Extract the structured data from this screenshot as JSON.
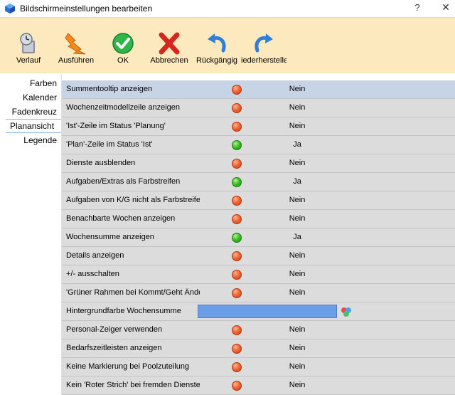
{
  "window": {
    "title": "Bildschirmeinstellungen bearbeiten",
    "help_label": "?",
    "close_label": "✕"
  },
  "toolbar": {
    "buttons": [
      {
        "label": "Verlauf",
        "icon": "history-icon"
      },
      {
        "label": "Ausführen",
        "icon": "execute-lightning-icon"
      },
      {
        "label": "OK",
        "icon": "ok-check-icon"
      },
      {
        "label": "Abbrechen",
        "icon": "cancel-x-icon"
      },
      {
        "label": "Rückgängig",
        "icon": "undo-arrow-icon"
      },
      {
        "label": "iederherstelle",
        "icon": "redo-arrow-icon"
      }
    ]
  },
  "sidebar": {
    "items": [
      {
        "label": "Farben",
        "active": false
      },
      {
        "label": "Kalender",
        "active": false
      },
      {
        "label": "Fadenkreuz",
        "active": false
      },
      {
        "label": "Planansicht",
        "active": true
      },
      {
        "label": "Legende",
        "active": false
      }
    ]
  },
  "colors": {
    "toolbar_bg": "#fde9be",
    "row_bg": "#dcdcdc",
    "selected_row_bg": "#c6d4e6",
    "status_no": "#e8562a",
    "status_yes": "#3fc22e",
    "color_field": "#6a9ee6"
  },
  "settings": [
    {
      "name": "Summentooltip anzeigen",
      "status": "red",
      "value": "Nein"
    },
    {
      "name": "Wochenzeitmodellzeile anzeigen",
      "status": "red",
      "value": "Nein"
    },
    {
      "name": "'Ist'-Zeile im Status 'Planung'",
      "status": "red",
      "value": "Nein"
    },
    {
      "name": "'Plan'-Zeile im Status 'Ist'",
      "status": "green",
      "value": "Ja"
    },
    {
      "name": "Dienste ausblenden",
      "status": "red",
      "value": "Nein"
    },
    {
      "name": "Aufgaben/Extras als Farbstreifen",
      "status": "green",
      "value": "Ja"
    },
    {
      "name": "Aufgaben von K/G nicht als Farbstreifen",
      "status": "red",
      "value": "Nein"
    },
    {
      "name": "Benachbarte Wochen anzeigen",
      "status": "red",
      "value": "Nein"
    },
    {
      "name": "Wochensumme anzeigen",
      "status": "green",
      "value": "Ja"
    },
    {
      "name": "Details anzeigen",
      "status": "red",
      "value": "Nein"
    },
    {
      "name": "+/- ausschalten",
      "status": "red",
      "value": "Nein"
    },
    {
      "name": "'Grüner Rahmen bei Kommt/Geht Änderung'",
      "status": "red",
      "value": "Nein"
    },
    {
      "name": "Hintergrundfarbe Wochensumme",
      "status": "color",
      "value": ""
    },
    {
      "name": "Personal-Zeiger verwenden",
      "status": "red",
      "value": "Nein"
    },
    {
      "name": "Bedarfszeitleisten anzeigen",
      "status": "red",
      "value": "Nein"
    },
    {
      "name": "Keine Markierung bei Poolzuteilung",
      "status": "red",
      "value": "Nein"
    },
    {
      "name": "Kein 'Roter Strich' bei fremden Diensten",
      "status": "red",
      "value": "Nein"
    }
  ]
}
